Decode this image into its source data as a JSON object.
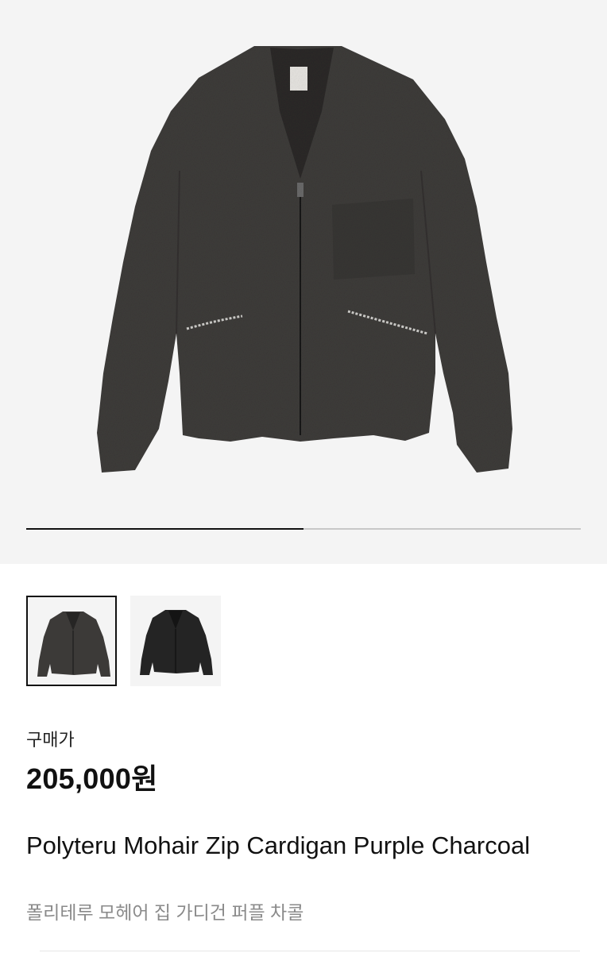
{
  "gallery": {
    "main_image_alt": "Polyteru Mohair Zip Cardigan Purple Charcoal",
    "progress": 0.5,
    "thumbnails": [
      {
        "name": "thumbnail-1",
        "selected": true,
        "color": "#3c3a38"
      },
      {
        "name": "thumbnail-2",
        "selected": false,
        "color": "#242424"
      }
    ]
  },
  "price": {
    "label": "구매가",
    "value": "205,000원"
  },
  "product": {
    "name": "Polyteru Mohair Zip Cardigan Purple Charcoal",
    "name_ko": "폴리테루 모헤어 집 가디건 퍼플 차콜"
  },
  "colors": {
    "garment": "#3e3c3a",
    "garment_dark": "#2b2a29",
    "background": "#f4f4f4"
  }
}
